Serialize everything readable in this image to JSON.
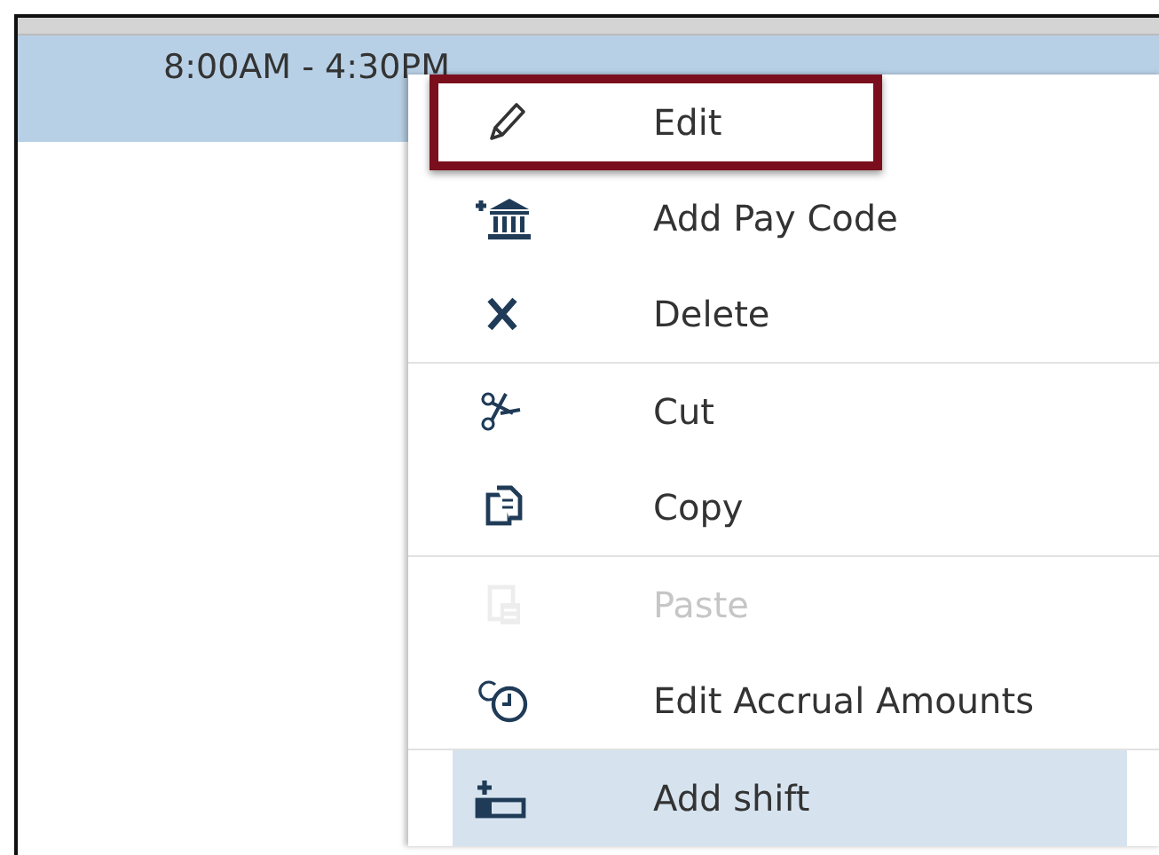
{
  "shift_row": {
    "time": "8:00AM - 4:30PM",
    "selected": true
  },
  "context_menu": {
    "groups": [
      [
        {
          "label": "Edit",
          "disabled": false,
          "highlighted": false,
          "outlined": true
        },
        {
          "label": "Add Pay Code",
          "disabled": false,
          "highlighted": false,
          "outlined": false
        },
        {
          "label": "Delete",
          "disabled": false,
          "highlighted": false,
          "outlined": false
        }
      ],
      [
        {
          "label": "Cut",
          "disabled": false,
          "highlighted": false,
          "outlined": false
        },
        {
          "label": "Copy",
          "disabled": false,
          "highlighted": false,
          "outlined": false
        }
      ],
      [
        {
          "label": "Paste",
          "disabled": true,
          "highlighted": false,
          "outlined": false
        },
        {
          "label": "Edit Accrual Amounts",
          "disabled": false,
          "highlighted": false,
          "outlined": false
        }
      ],
      [
        {
          "label": "Add shift",
          "disabled": false,
          "highlighted": true,
          "outlined": false
        }
      ]
    ]
  }
}
